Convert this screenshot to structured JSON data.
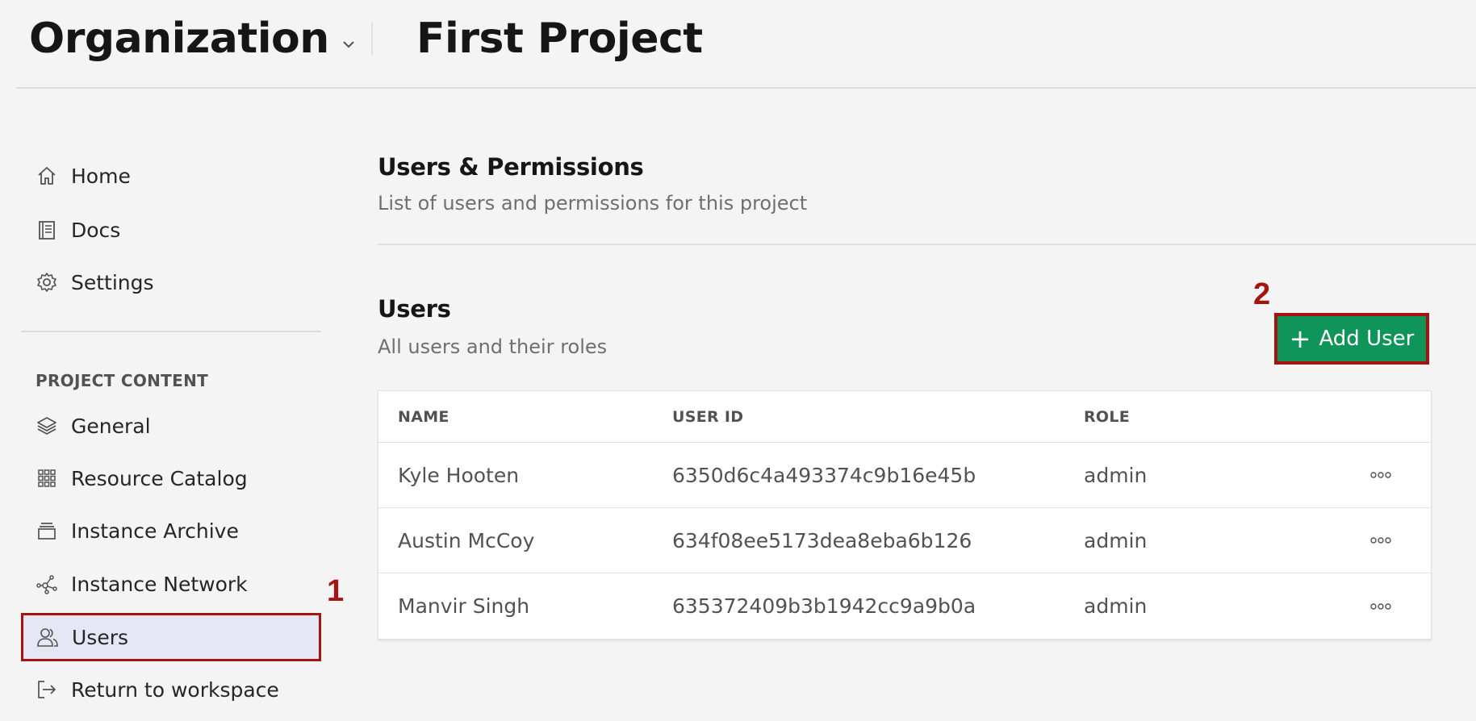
{
  "header": {
    "org_title": "Organization",
    "project_title": "First Project"
  },
  "sidebar": {
    "items": [
      {
        "label": "Home",
        "icon": "home-icon"
      },
      {
        "label": "Docs",
        "icon": "docs-icon"
      },
      {
        "label": "Settings",
        "icon": "gear-icon"
      }
    ],
    "section_label": "PROJECT CONTENT",
    "content_items": [
      {
        "label": "General",
        "icon": "layers-icon"
      },
      {
        "label": "Resource Catalog",
        "icon": "grid-icon"
      },
      {
        "label": "Instance Archive",
        "icon": "archive-icon"
      },
      {
        "label": "Instance Network",
        "icon": "network-icon"
      },
      {
        "label": "Users",
        "icon": "users-icon",
        "active": true
      },
      {
        "label": "Return to workspace",
        "icon": "return-icon"
      }
    ]
  },
  "main": {
    "title": "Users & Permissions",
    "subtitle": "List of users and permissions for this project",
    "users_title": "Users",
    "users_subtitle": "All users and their roles",
    "add_button_label": "Add User",
    "table": {
      "headers": [
        "NAME",
        "USER ID",
        "ROLE"
      ],
      "rows": [
        {
          "name": "Kyle Hooten",
          "user_id": "6350d6c4a493374c9b16e45b",
          "role": "admin"
        },
        {
          "name": "Austin McCoy",
          "user_id": "634f08ee5173dea8eba6b126",
          "role": "admin"
        },
        {
          "name": "Manvir Singh",
          "user_id": "635372409b3b1942cc9a9b0a",
          "role": "admin"
        }
      ]
    }
  },
  "callouts": [
    "1",
    "2"
  ],
  "colors": {
    "accent_green": "#0f955a",
    "callout_red": "#a5140e",
    "active_bg": "#e5e8f4"
  }
}
